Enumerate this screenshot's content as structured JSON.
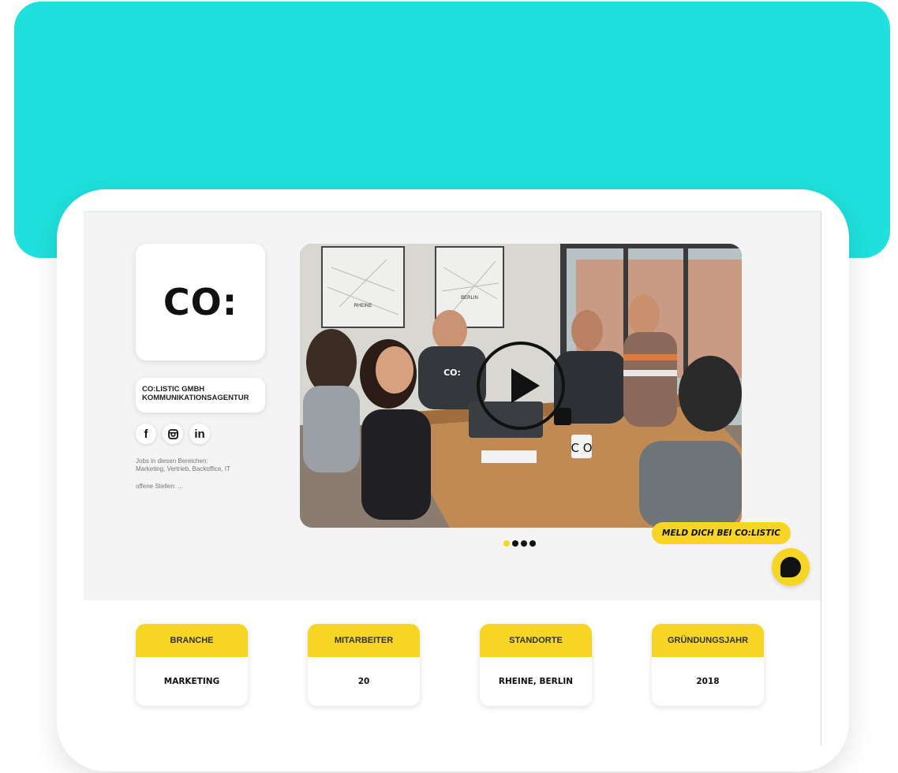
{
  "company": {
    "logo_text": "CO:",
    "name_line1": "CO:LISTIC GMBH",
    "name_line2": "KOMMUNIKATIONSAGENTUR"
  },
  "socials": [
    {
      "icon": "facebook-icon",
      "label": "f"
    },
    {
      "icon": "instagram-icon",
      "label": ""
    },
    {
      "icon": "linkedin-icon",
      "label": "in"
    }
  ],
  "jobs": {
    "line1": "Jobs in diesen Bereichen:",
    "line2": "Marketing, Vertrieb, Backoffice, IT",
    "open_positions": "offene Stellen: ..."
  },
  "video": {
    "map_labels": [
      "RHEINE",
      "BERLIN"
    ],
    "mug_text": "C O",
    "shirt_text": "CO:"
  },
  "carousel": {
    "slide_count": 4,
    "active_index": 0
  },
  "contact_badge": "MELD DICH BEI CO:LISTIC",
  "facts": [
    {
      "label": "BRANCHE",
      "value": "MARKETING"
    },
    {
      "label": "MITARBEITER",
      "value": "20"
    },
    {
      "label": "STANDORTE",
      "value": "RHEINE, BERLIN"
    },
    {
      "label": "GRÜNDUNGSJAHR",
      "value": "2018"
    }
  ],
  "colors": {
    "teal": "#1fe0dc",
    "yellow": "#f6d524",
    "dark": "#111111"
  }
}
